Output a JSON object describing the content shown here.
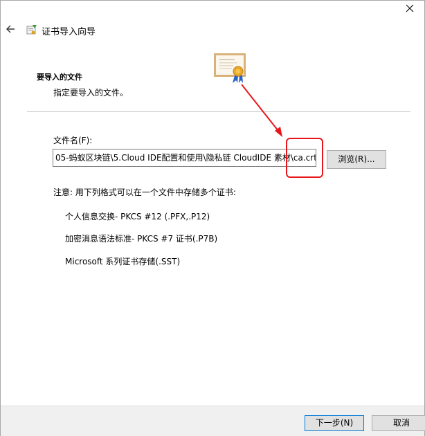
{
  "window": {
    "title": "证书导入向导",
    "close_glyph": "✕"
  },
  "header": {
    "section_title": "要导入的文件",
    "section_subtitle": "指定要导入的文件。"
  },
  "form": {
    "file_label": "文件名(F):",
    "file_value": "05-蚂蚁区块链\\5.Cloud IDE配置和使用\\隐私链 CloudIDE 素材\\ca.crt",
    "browse_label": "浏览(R)..."
  },
  "info": {
    "note": "注意: 用下列格式可以在一个文件中存储多个证书:",
    "formats": [
      "个人信息交换- PKCS #12 (.PFX,.P12)",
      "加密消息语法标准- PKCS #7 证书(.P7B)",
      "Microsoft 系列证书存储(.SST)"
    ]
  },
  "footer": {
    "next_label": "下一步(N)",
    "cancel_label": "取消"
  },
  "colors": {
    "annotation": "#e8161a",
    "primary_border": "#0078d7"
  },
  "icons": {
    "back": "back-arrow-icon",
    "wizard": "certificate-wizard-icon",
    "certificate": "certificate-icon",
    "close": "close-icon"
  }
}
